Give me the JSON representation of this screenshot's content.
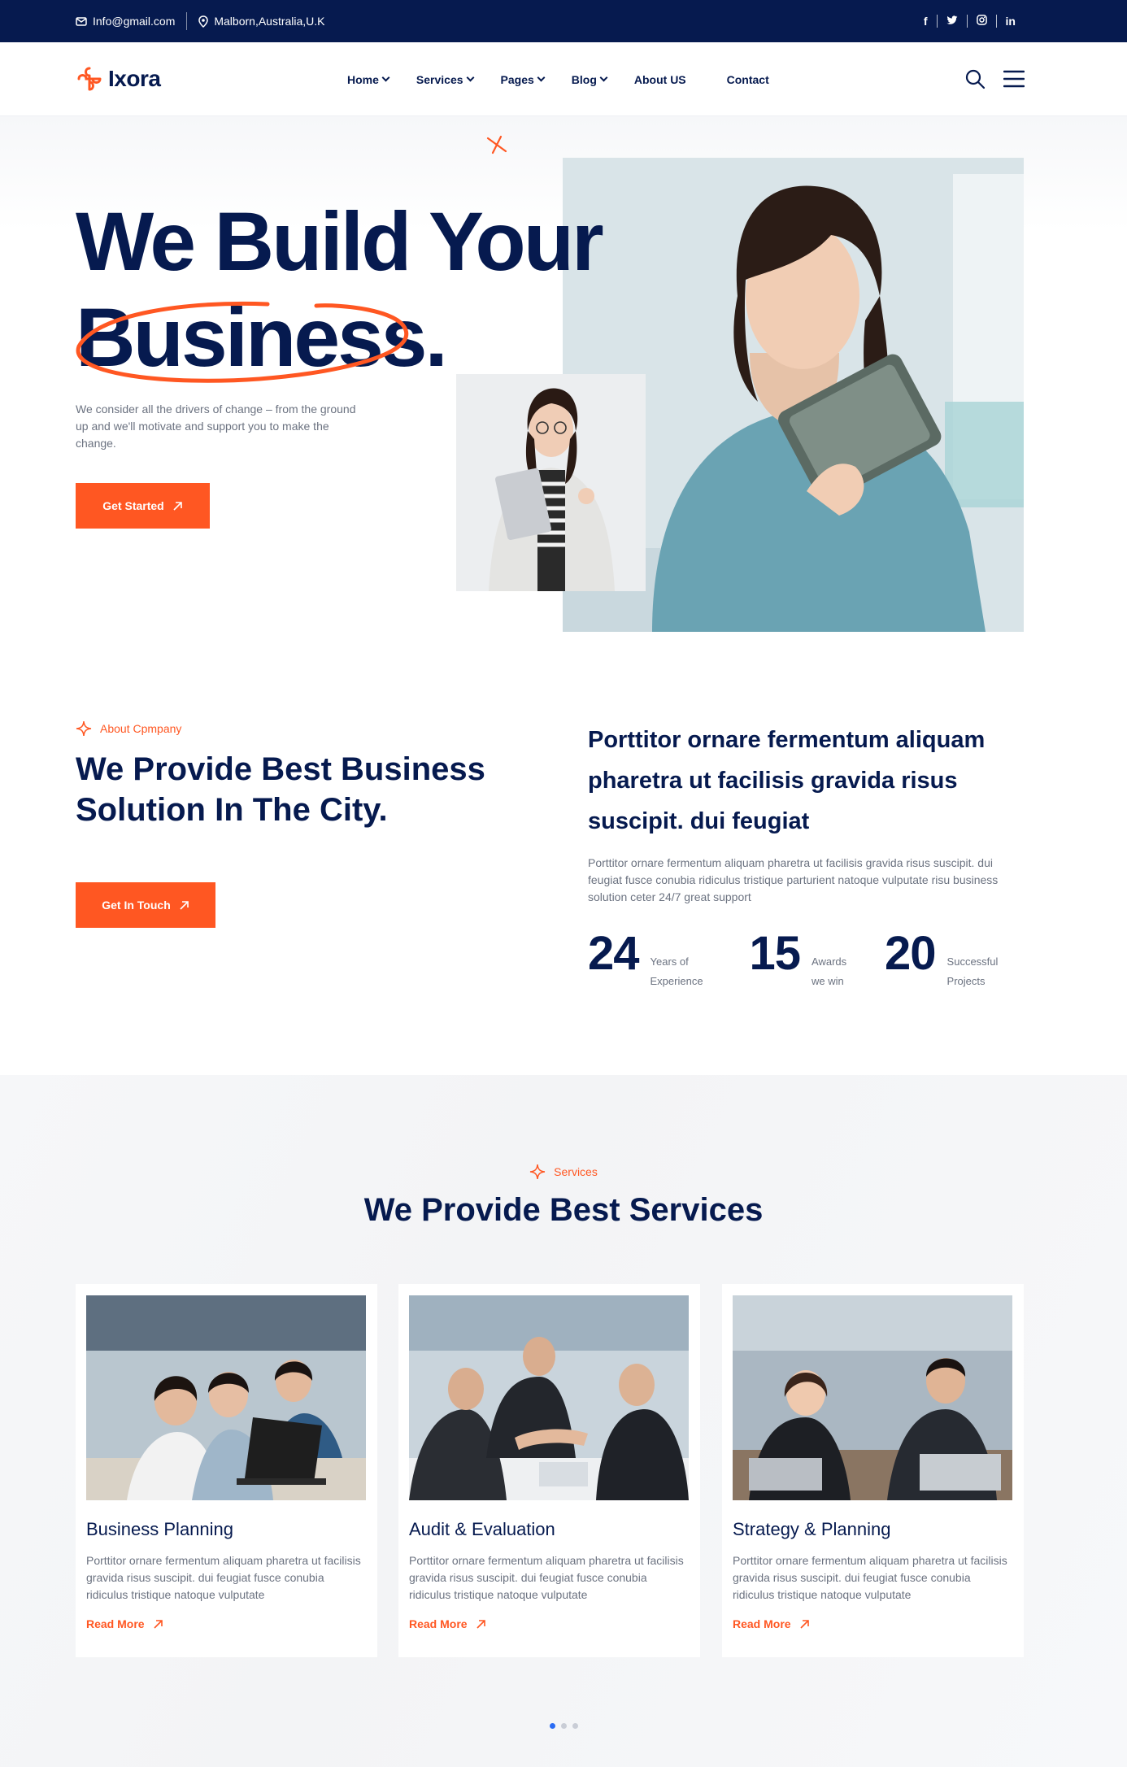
{
  "topbar": {
    "email": "Info@gmail.com",
    "location": "Malborn,Australia,U.K",
    "social": [
      "f",
      "twitter",
      "instagram",
      "in"
    ]
  },
  "brand": {
    "name": "Ixora"
  },
  "nav": {
    "items": [
      {
        "label": "Home",
        "dropdown": true
      },
      {
        "label": "Services",
        "dropdown": true
      },
      {
        "label": "Pages",
        "dropdown": true
      },
      {
        "label": "Blog",
        "dropdown": true
      },
      {
        "label": "About US",
        "dropdown": false
      },
      {
        "label": "Contact",
        "dropdown": false
      }
    ]
  },
  "hero": {
    "title_line1": "We Build Your",
    "title_line2": "Business.",
    "description": "We consider all the drivers of change – from the ground up and we'll motivate and support you to make the change.",
    "cta": "Get Started"
  },
  "about": {
    "tag": "About Cpmpany",
    "title": "We Provide Best Business Solution In The City.",
    "cta": "Get In Touch",
    "right_title": "Porttitor ornare fermentum aliquam pharetra ut facilisis gravida risus suscipit. dui feugiat",
    "right_desc": "Porttitor ornare fermentum aliquam pharetra ut facilisis gravida risus suscipit. dui feugiat fusce conubia ridiculus tristique parturient natoque vulputate risu business solution ceter 24/7 great support",
    "stats": [
      {
        "number": "24",
        "line1": "Years of",
        "line2": "Experience"
      },
      {
        "number": "15",
        "line1": "Awards",
        "line2": "we win"
      },
      {
        "number": "20",
        "line1": "Successful",
        "line2": "Projects"
      }
    ]
  },
  "services": {
    "tag": "Services",
    "title": "We Provide Best Services",
    "cards": [
      {
        "title": "Business Planning",
        "desc": "Porttitor ornare fermentum aliquam pharetra ut facilisis gravida risus suscipit. dui feugiat fusce conubia ridiculus tristique natoque vulputate",
        "link": "Read More"
      },
      {
        "title": "Audit & Evaluation",
        "desc": "Porttitor ornare fermentum aliquam pharetra ut facilisis gravida risus suscipit. dui feugiat fusce conubia ridiculus tristique natoque vulputate",
        "link": "Read More"
      },
      {
        "title": "Strategy & Planning",
        "desc": "Porttitor ornare fermentum aliquam pharetra ut facilisis gravida risus suscipit. dui feugiat fusce conubia ridiculus tristique natoque vulputate",
        "link": "Read More"
      }
    ],
    "pager_active": 1
  },
  "colors": {
    "navy": "#061a4f",
    "accent": "#ff5722",
    "muted": "#6b7280"
  }
}
